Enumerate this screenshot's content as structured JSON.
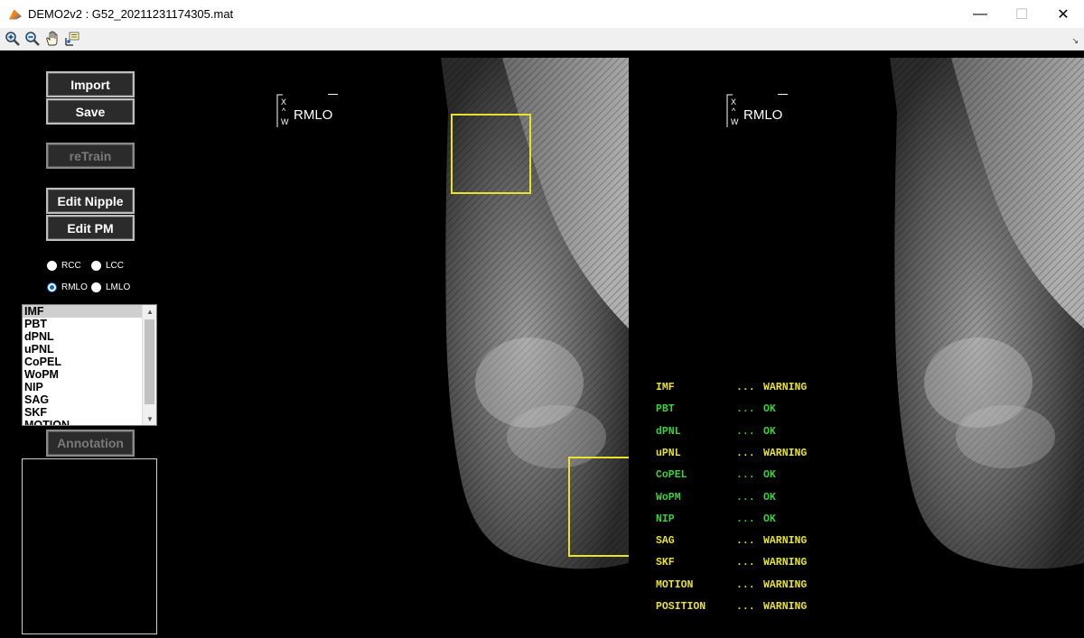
{
  "window": {
    "title": "DEMO2v2 : G52_20211231174305.mat",
    "minimize_glyph": "—",
    "maximize_glyph": "☐",
    "close_glyph": "✕"
  },
  "toolbar": {
    "tools": [
      "zoom-in-icon",
      "zoom-out-icon",
      "pan-hand-icon",
      "data-cursor-icon"
    ],
    "corner_glyph": "↘"
  },
  "buttons": {
    "import": "Import",
    "save": "Save",
    "retrain": "reTrain",
    "edit_nipple": "Edit Nipple",
    "edit_pm": "Edit PM",
    "annotation": "Annotation"
  },
  "views": {
    "options": [
      "RCC",
      "LCC",
      "RMLO",
      "LMLO"
    ],
    "selected": "RMLO"
  },
  "criteria_list": {
    "items": [
      "IMF",
      "PBT",
      "dPNL",
      "uPNL",
      "CoPEL",
      "WoPM",
      "NIP",
      "SAG",
      "SKF",
      "MOTION"
    ],
    "selected": "IMF"
  },
  "left_image": {
    "orientation_label": "RMLO",
    "orientation_top": "X",
    "orientation_arrow": "^",
    "orientation_bottom": "W"
  },
  "right_image": {
    "orientation_label": "RMLO",
    "orientation_top": "X",
    "orientation_arrow": "^",
    "orientation_bottom": "W"
  },
  "report": {
    "dots": "...",
    "rows": [
      {
        "code": "IMF",
        "status": "WARNING"
      },
      {
        "code": "PBT",
        "status": "OK"
      },
      {
        "code": "dPNL",
        "status": "OK"
      },
      {
        "code": "uPNL",
        "status": "WARNING"
      },
      {
        "code": "CoPEL",
        "status": "OK"
      },
      {
        "code": "WoPM",
        "status": "OK"
      },
      {
        "code": "NIP",
        "status": "OK"
      },
      {
        "code": "SAG",
        "status": "WARNING"
      },
      {
        "code": "SKF",
        "status": "WARNING"
      },
      {
        "code": "MOTION",
        "status": "WARNING"
      },
      {
        "code": "POSITION",
        "status": "WARNING"
      }
    ],
    "colors": {
      "WARNING": "#e8e22a",
      "OK": "#3fcf3f"
    }
  },
  "colors": {
    "bbox": "#e8e22a",
    "radio_accent": "#0a64c8"
  }
}
